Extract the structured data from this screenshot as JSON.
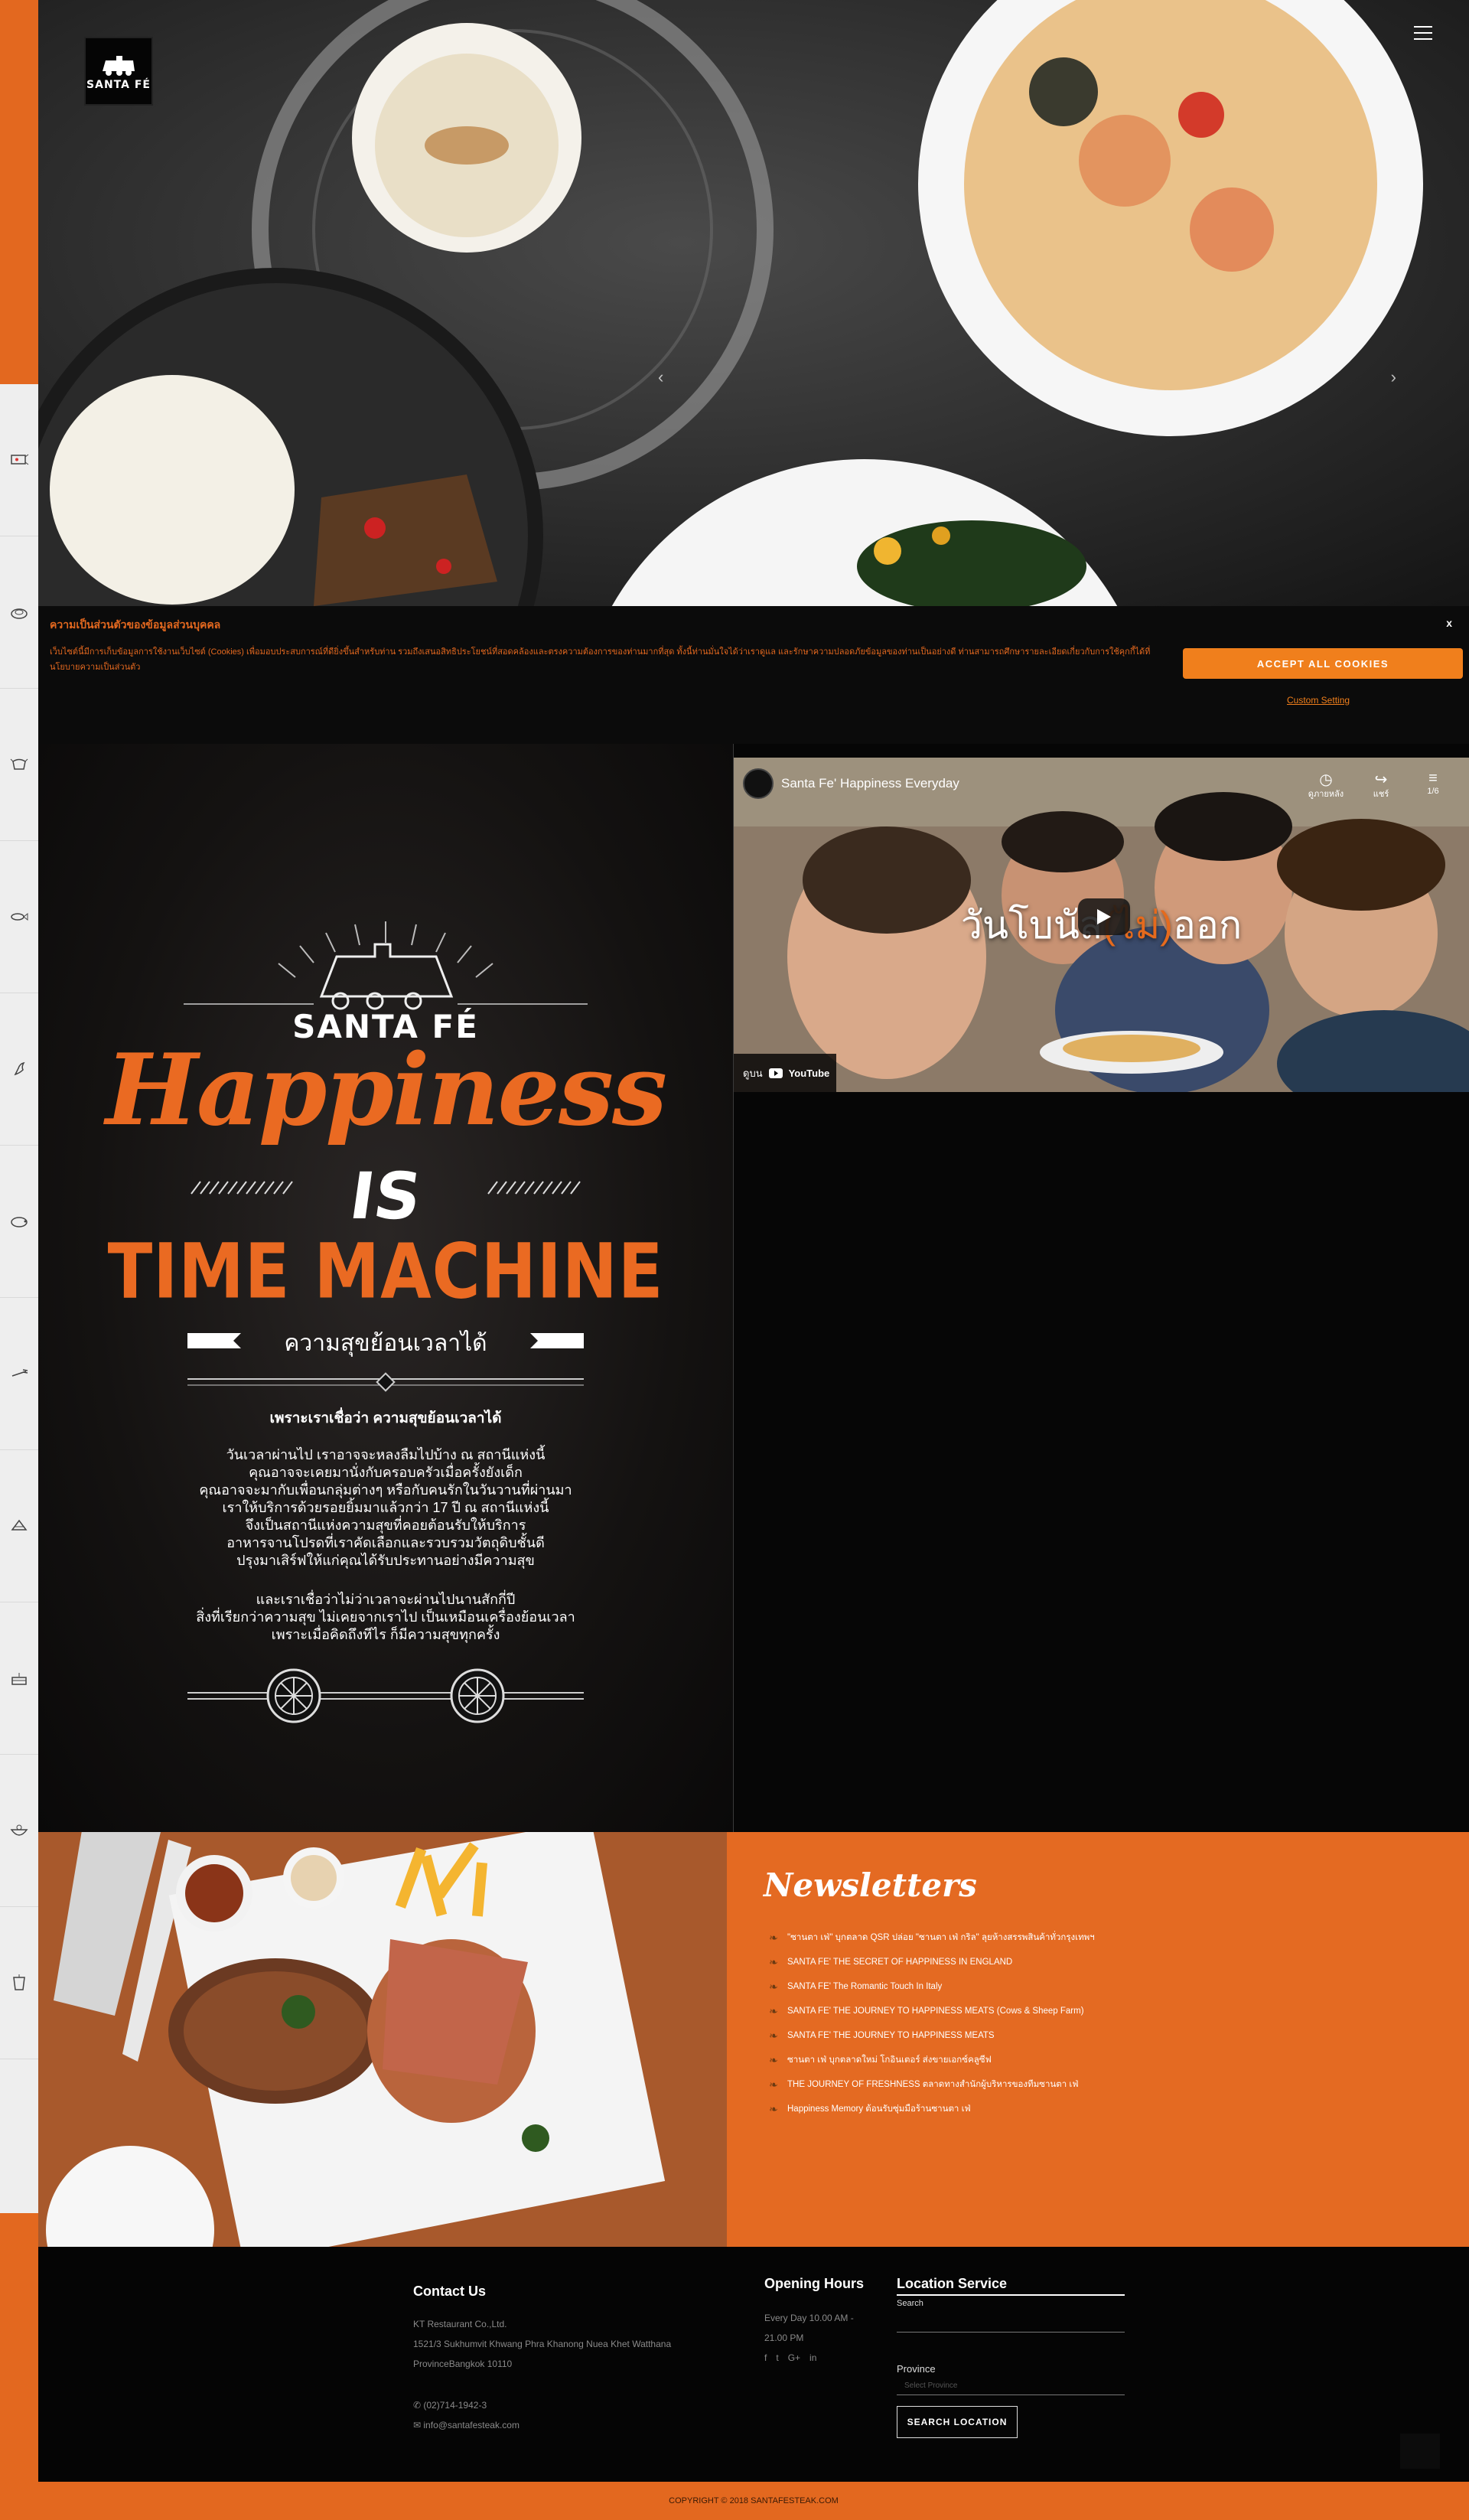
{
  "hero": {
    "brand_logo": "SANTA FÉ"
  },
  "cookie": {
    "title": "ความเป็นส่วนตัวของข้อมูลส่วนบุคคล",
    "close_label": "x",
    "text": "เว็บไซต์นี้มีการเก็บข้อมูลการใช้งานเว็บไซต์ (Cookies) เพื่อมอบประสบการณ์ที่ดียิ่งขึ้นสำหรับท่าน รวมถึงเสนอสิทธิประโยชน์ที่สอดคล้องและตรงความต้องการของท่านมากที่สุด ทั้งนี้ท่านมั่นใจได้ว่าเราดูแล และรักษาความปลอดภัยข้อมูลของท่านเป็นอย่างดี ท่านสามารถศึกษารายละเอียดเกี่ยวกับการใช้คุกกี้ได้ที่ นโยบายความเป็นส่วนตัว",
    "accept_label": "ACCEPT ALL COOKIES",
    "custom_label": "Custom Setting"
  },
  "poster": {
    "brand": "SANTA FÉ",
    "headline": "Happiness",
    "is": "IS",
    "machine": "TIME MACHINE",
    "banner": "ความสุขย้อนเวลาได้",
    "subtitle": "เพราะเราเชื่อว่า ความสุขย้อนเวลาได้",
    "para1": [
      "วันเวลาผ่านไป เราอาจจะหลงลืมไปบ้าง ณ สถานีแห่งนี้",
      "คุณอาจจะเคยมานั่งกับครอบครัวเมื่อครั้งยังเด็ก",
      "คุณอาจจะมากับเพื่อนกลุ่มต่างๆ หรือกับคนรักในวันวานที่ผ่านมา",
      "เราให้บริการด้วยรอยยิ้มมาแล้วกว่า 17 ปี ณ สถานีแห่งนี้",
      "จึงเป็นสถานีแห่งความสุขที่คอยต้อนรับให้บริการ",
      "อาหารจานโปรดที่เราคัดเลือกและรวบรวมวัตถุดิบชั้นดี",
      "ปรุงมาเสิร์ฟให้แก่คุณได้รับประทานอย่างมีความสุข"
    ],
    "para2": [
      "และเราเชื่อว่าไม่ว่าเวลาจะผ่านไปนานสักกี่ปี",
      "สิ่งที่เรียกว่าความสุข ไม่เคยจากเราไป เป็นเหมือนเครื่องย้อนเวลา",
      "เพราะเมื่อคิดถึงทีไร ก็มีความสุขทุกครั้ง"
    ]
  },
  "video": {
    "title": "Santa Fe' Happiness Everyday",
    "watch_later": "ดูภายหลัง",
    "share": "แชร์",
    "playlist": "1/6",
    "caption_a": "วันโบนัส",
    "caption_bracket_open": "(",
    "caption_mid": "ไม่",
    "caption_bracket_close": ")",
    "caption_b": "ออก",
    "watch_on": "ดูบน",
    "youtube": "YouTube"
  },
  "newsletter": {
    "title": "Newsletters",
    "items": [
      "\"ซานตา เฟ่\" บุกตลาด QSR ปล่อย \"ซานตา เฟ่ กริล\" ลุยห้างสรรพสินค้าทั่วกรุงเทพฯ",
      "SANTA FE' THE SECRET OF HAPPINESS IN ENGLAND",
      "SANTA FE' The Romantic Touch In Italy",
      "SANTA FE' THE JOURNEY TO HAPPINESS MEATS (Cows & Sheep Farm)",
      "SANTA FE' THE JOURNEY TO HAPPINESS MEATS",
      "ซานตา เฟ่ บุกตลาดใหม่ โกอินเตอร์ ส่งขายเอกซ์คลูซีฟ",
      "THE JOURNEY OF FRESHNESS ตลาดทางสำนักผู้บริหารของทีมซานตา เฟ่",
      "Happiness Memory ต้อนรับซุ่มมือร้านซานตา เฟ่"
    ]
  },
  "footer": {
    "contact_title": "Contact Us",
    "company": "KT Restaurant Co.,Ltd.",
    "address1": "1521/3 Sukhumvit Khwang Phra Khanong Nuea Khet Watthana",
    "address2": "ProvinceBangkok 10110",
    "phone": "(02)714-1942-3",
    "email": "info@santafesteak.com",
    "hours_title": "Opening Hours",
    "hours1": "Every Day 10.00 AM -",
    "hours2": "21.00 PM",
    "social": [
      "f",
      "t",
      "G+",
      "in"
    ],
    "location_title": "Location Service",
    "search_label": "Search",
    "search_value": "",
    "province_label": "Province",
    "province_placeholder": "Select Province",
    "search_button": "SEARCH LOCATION"
  },
  "copyright": "COPYRIGHT © 2018 SANTAFESTEAK.COM",
  "colors": {
    "brand_orange": "#e3681f",
    "button_orange": "#f07f1c",
    "background": "#060606"
  }
}
